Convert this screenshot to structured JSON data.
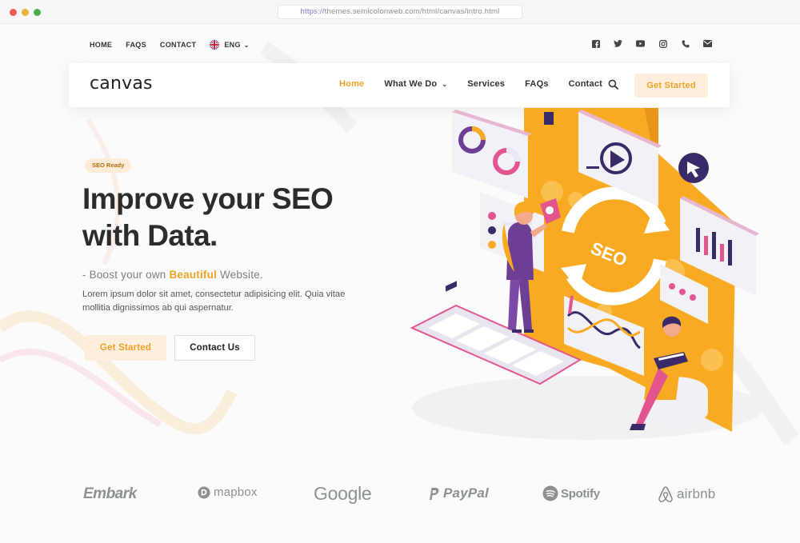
{
  "browser": {
    "url_protocol": "https://",
    "url_rest": "themes.semicolonweb.com/html/canvas/intro.html"
  },
  "topbar": {
    "links": [
      "HOME",
      "FAQS",
      "CONTACT"
    ],
    "language": "ENG",
    "social_icons": [
      "facebook-icon",
      "twitter-icon",
      "youtube-icon",
      "instagram-icon",
      "phone-icon",
      "email-icon"
    ]
  },
  "nav": {
    "logo": "canvas",
    "items": [
      {
        "label": "Home",
        "active": true
      },
      {
        "label": "What We Do",
        "dropdown": true
      },
      {
        "label": "Services"
      },
      {
        "label": "FAQs"
      },
      {
        "label": "Contact"
      }
    ],
    "cta": "Get Started"
  },
  "hero": {
    "badge": "SEO Ready",
    "heading_line1": "Improve your SEO",
    "heading_line2": "with Data.",
    "sub_prefix": "- Boost your own ",
    "sub_highlight": "Beautiful",
    "sub_suffix": " Website.",
    "paragraph": "Lorem ipsum dolor sit amet, consectetur adipisicing elit. Quia vitae mollitia dignissimos ab qui aspernatur.",
    "primary_button": "Get Started",
    "secondary_button": "Contact Us",
    "illustration_text": "SEO"
  },
  "brands": [
    "Embark",
    "mapbox",
    "Google",
    "PayPal",
    "Spotify",
    "airbnb"
  ],
  "colors": {
    "accent": "#f0a227",
    "accent_soft": "#fdeede",
    "text_dark": "#2c2c2c",
    "brand_gray": "#8a9191"
  }
}
